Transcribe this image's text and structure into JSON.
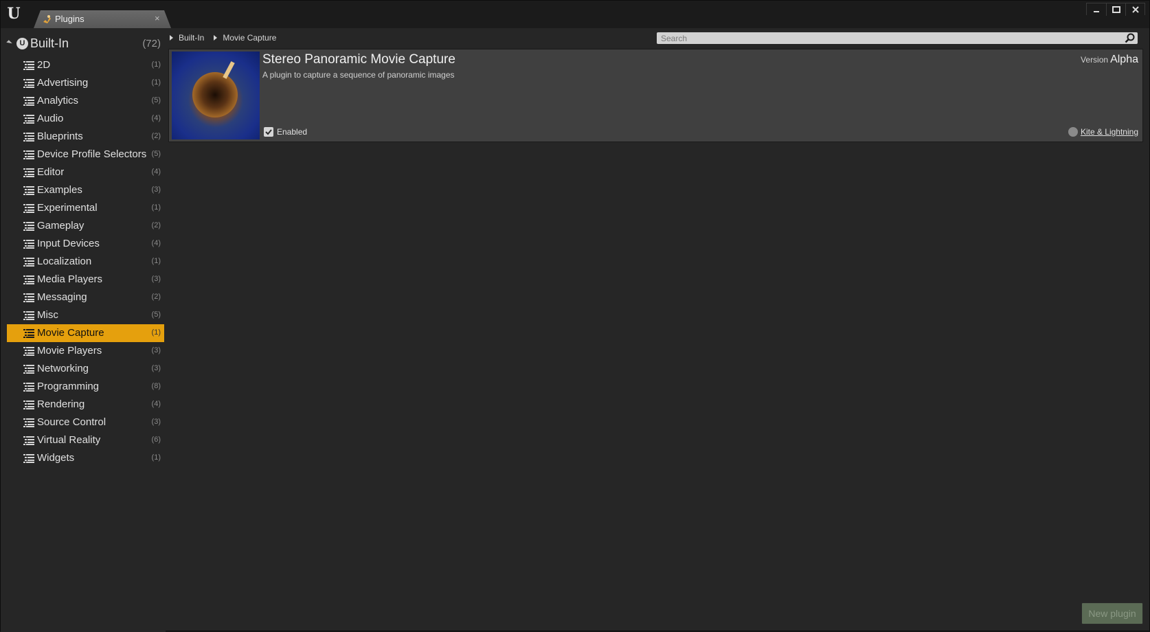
{
  "window": {
    "logo": "U",
    "tab_label": "Plugins",
    "tab_close": "×",
    "controls": {
      "minimize": "▁",
      "maximize": "□",
      "close": "✕"
    }
  },
  "sidebar": {
    "root_label": "Built-In",
    "root_count": "(72)",
    "items": [
      {
        "label": "2D",
        "count": "(1)"
      },
      {
        "label": "Advertising",
        "count": "(1)"
      },
      {
        "label": "Analytics",
        "count": "(5)"
      },
      {
        "label": "Audio",
        "count": "(4)"
      },
      {
        "label": "Blueprints",
        "count": "(2)"
      },
      {
        "label": "Device Profile Selectors",
        "count": "(5)"
      },
      {
        "label": "Editor",
        "count": "(4)"
      },
      {
        "label": "Examples",
        "count": "(3)"
      },
      {
        "label": "Experimental",
        "count": "(1)"
      },
      {
        "label": "Gameplay",
        "count": "(2)"
      },
      {
        "label": "Input Devices",
        "count": "(4)"
      },
      {
        "label": "Localization",
        "count": "(1)"
      },
      {
        "label": "Media Players",
        "count": "(3)"
      },
      {
        "label": "Messaging",
        "count": "(2)"
      },
      {
        "label": "Misc",
        "count": "(5)"
      },
      {
        "label": "Movie Capture",
        "count": "(1)"
      },
      {
        "label": "Movie Players",
        "count": "(3)"
      },
      {
        "label": "Networking",
        "count": "(3)"
      },
      {
        "label": "Programming",
        "count": "(8)"
      },
      {
        "label": "Rendering",
        "count": "(4)"
      },
      {
        "label": "Source Control",
        "count": "(3)"
      },
      {
        "label": "Virtual Reality",
        "count": "(6)"
      },
      {
        "label": "Widgets",
        "count": "(1)"
      }
    ],
    "selected_label": "Movie Capture"
  },
  "breadcrumb": {
    "items": [
      "Built-In",
      "Movie Capture"
    ]
  },
  "search": {
    "placeholder": "Search",
    "value": ""
  },
  "plugin": {
    "title": "Stereo Panoramic Movie Capture",
    "description": "A plugin to capture a sequence of panoramic images",
    "version_label": "Version",
    "version_value": "Alpha",
    "enabled_label": "Enabled",
    "enabled": true,
    "author": "Kite & Lightning"
  },
  "footer": {
    "new_plugin_label": "New plugin"
  },
  "colors": {
    "selected_bg": "#e5a00d",
    "panel_bg": "#262626",
    "card_bg": "#404040"
  }
}
